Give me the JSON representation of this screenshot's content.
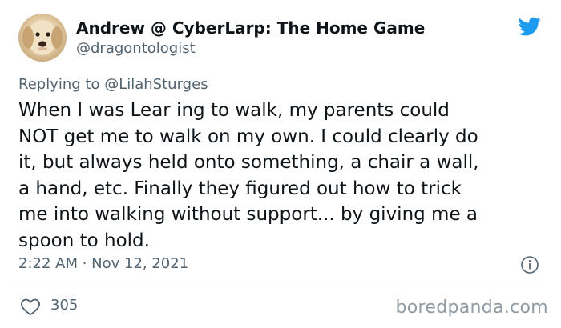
{
  "tweet": {
    "author": {
      "display_name": "Andrew @ CyberLarp: The Home Game",
      "handle": "@dragontologist",
      "avatar_icon": "dog-avatar-icon"
    },
    "reply_prefix": "Replying to ",
    "reply_to": "@LilahSturges",
    "text_lines": [
      "When I was Lear ing to walk, my parents could",
      "NOT get me to walk on my own. I could clearly do",
      "it, but always held onto something, a chair a wall,",
      "a hand, etc. Finally they figured out how to trick",
      "me into walking without support... by giving me a",
      "spoon to hold."
    ],
    "timestamp": "2:22 AM · Nov 12, 2021",
    "likes": "305"
  },
  "icons": {
    "brand": "twitter-bird-icon",
    "info": "info-icon",
    "like": "heart-icon"
  },
  "colors": {
    "brand_blue": "#1d9bf0",
    "secondary_text": "#536471",
    "primary_text": "#0f1419",
    "divider": "#cfd9de",
    "watermark": "#8f9aa3"
  },
  "watermark": "boredpanda.com"
}
